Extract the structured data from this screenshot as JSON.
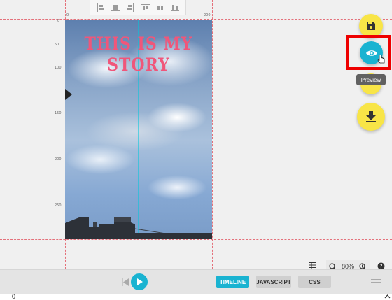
{
  "align_toolbar": {
    "buttons": [
      "align-left-icon",
      "align-center-icon",
      "align-right-icon",
      "align-top-icon",
      "align-middle-icon",
      "align-bottom-icon"
    ]
  },
  "ruler": {
    "top_labels": [
      "0",
      "200"
    ],
    "left_labels": [
      "0",
      "50",
      "100",
      "150",
      "200",
      "250"
    ]
  },
  "canvas": {
    "story_title": "THIS IS MY STORY",
    "title_color": "#f0567a"
  },
  "fab": {
    "save": "save-icon",
    "preview": "eye-icon",
    "download": "download-icon",
    "preview_tooltip": "Preview"
  },
  "colors": {
    "accent": "#1ab3d1",
    "fab": "#f8e547",
    "highlight": "#ee0000"
  },
  "zoom": {
    "level": "80%"
  },
  "bottom_bar": {
    "tabs": [
      {
        "label": "TIMELINE",
        "active": true
      },
      {
        "label": "JAVASCRIPT",
        "active": false
      },
      {
        "label": "CSS",
        "active": false
      }
    ]
  },
  "footer": {
    "value": "0"
  }
}
